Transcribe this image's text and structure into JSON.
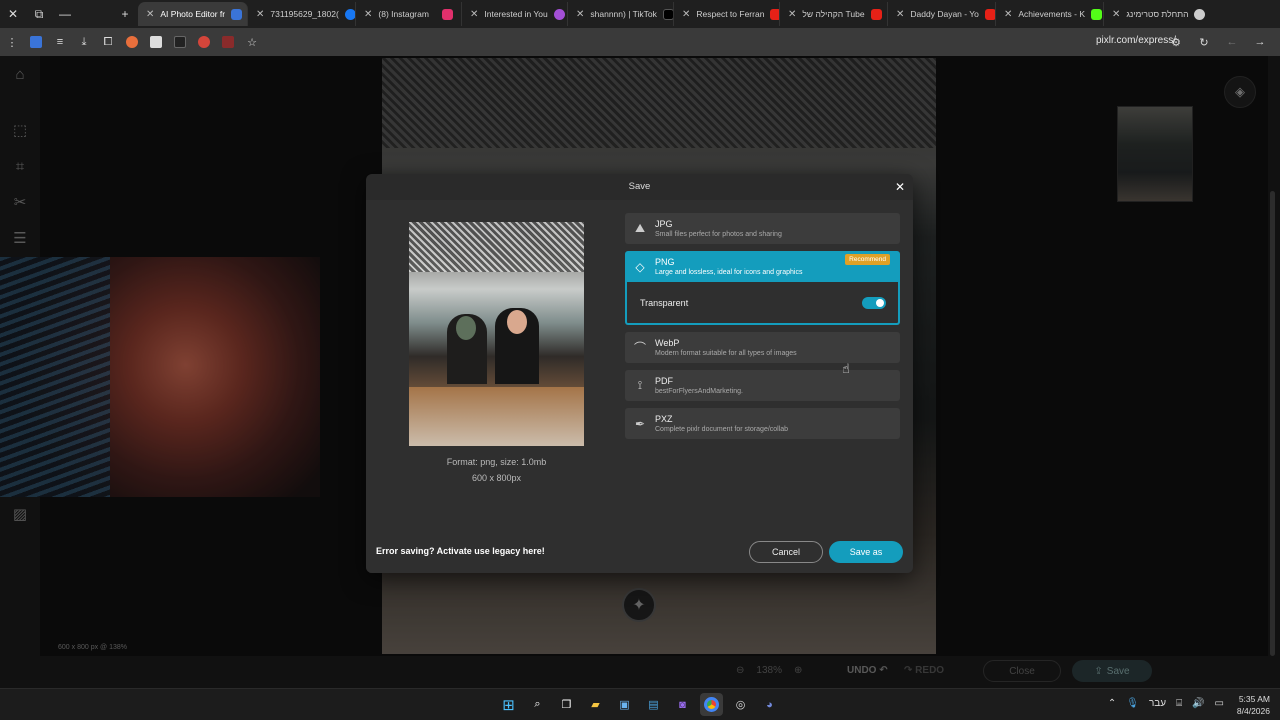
{
  "browser": {
    "tabs": [
      {
        "label": "AI Photo Editor fr",
        "active": true
      },
      {
        "label": "731195629_1802(",
        "active": false
      },
      {
        "label": "(8) Instagram",
        "active": false
      },
      {
        "label": "Interested in You",
        "active": false
      },
      {
        "label": "shannnn) | TikTok",
        "active": false
      },
      {
        "label": "Respect to Ferran",
        "active": false
      },
      {
        "label": "הקהילה של Tube",
        "active": false
      },
      {
        "label": "Daddy Dayan - Yo",
        "active": false
      },
      {
        "label": "Achievements - K",
        "active": false
      },
      {
        "label": "התחלת סטרימינג",
        "active": false
      }
    ],
    "new_tab": "+",
    "address": "pixlr.com/express/"
  },
  "editor": {
    "canvas_dims": "600 x 800 px @ 138%",
    "zoom": "138%",
    "undo_label": "UNDO",
    "redo_label": "REDO",
    "close_label": "Close",
    "save_label": "Save"
  },
  "dialog": {
    "title": "Save",
    "close": "✕",
    "format_info": "Format: png, size: 1.0mb",
    "dimensions": "600 x 800px",
    "options": [
      {
        "name": "JPG",
        "desc": "Small files perfect for photos and sharing"
      },
      {
        "name": "PNG",
        "desc": "Large and lossless, ideal for icons and graphics",
        "badge": "Recommend",
        "selected": true
      },
      {
        "name": "WebP",
        "desc": "Modern format suitable for all types of images"
      },
      {
        "name": "PDF",
        "desc": "bestForFlyersAndMarketing."
      },
      {
        "name": "PXZ",
        "desc": "Complete pixlr document for storage/collab"
      }
    ],
    "transparent_label": "Transparent",
    "transparent_on": true,
    "legacy_text": "Error saving? Activate use legacy here!",
    "cancel_label": "Cancel",
    "save_as_label": "Save as"
  },
  "taskbar": {
    "lang": "עבר",
    "time": "5:35 AM",
    "date": "8/4/2026"
  },
  "colors": {
    "accent": "#149dbd",
    "badge": "#e0a126"
  }
}
